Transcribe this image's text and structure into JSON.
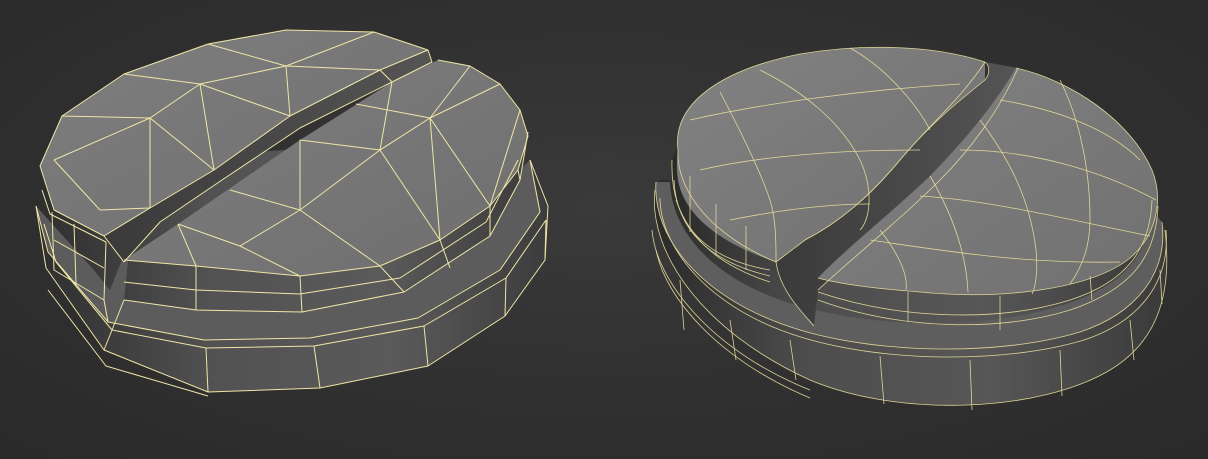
{
  "scene": {
    "background": "#2e2e2e",
    "wireframe_color": "#efe6a6",
    "surface_top_color": "#7a7a7a",
    "surface_side_color": "#4a4a4a",
    "objects": [
      {
        "name": "low-poly-slotted-cap",
        "style": "faceted wireframe over shaded mesh"
      },
      {
        "name": "smoothed-slotted-cap",
        "style": "subdivided wireframe over shaded mesh"
      }
    ]
  }
}
